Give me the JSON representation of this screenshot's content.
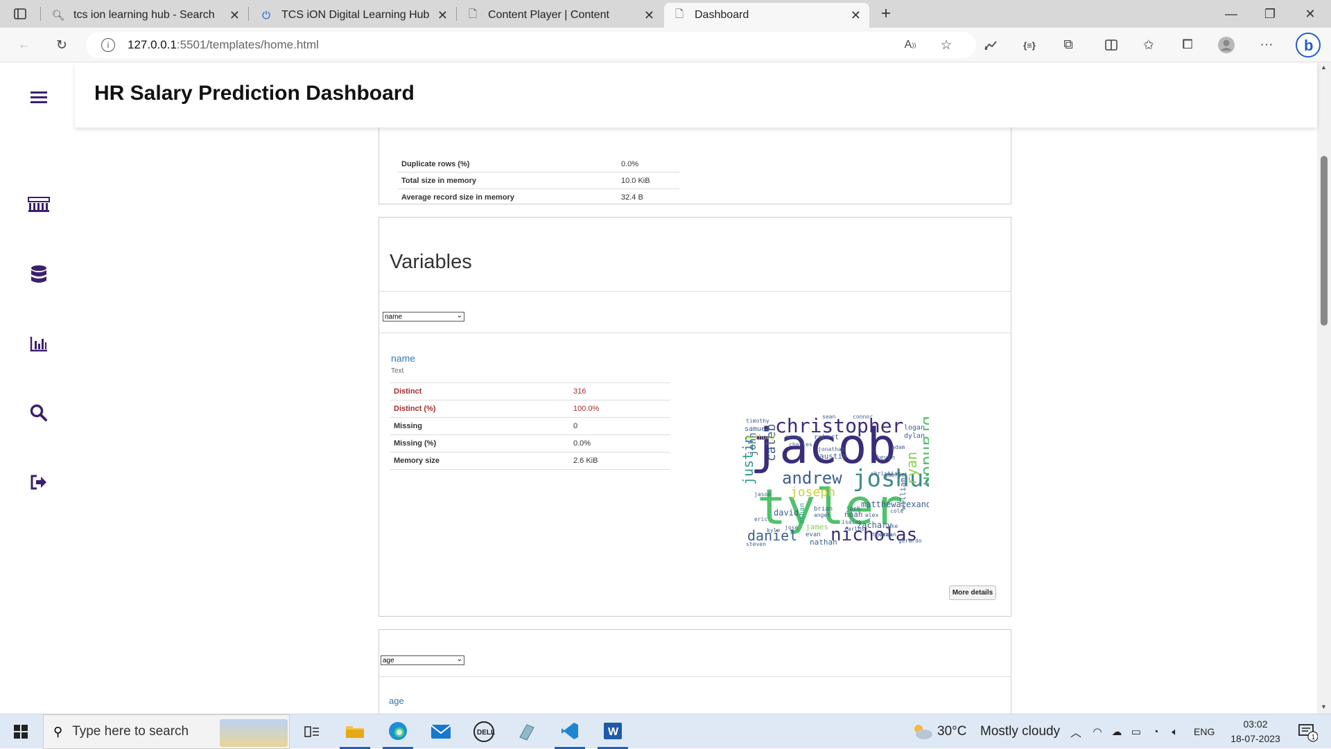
{
  "browser": {
    "tabs": [
      {
        "title": "tcs ion learning hub - Search"
      },
      {
        "title": "TCS iON Digital Learning Hub"
      },
      {
        "title": "Content Player | Content"
      },
      {
        "title": "Dashboard"
      }
    ],
    "url_host": "127.0.0.1",
    "url_path": ":5501/templates/home.html"
  },
  "header": {
    "title": "HR Salary Prediction Dashboard"
  },
  "overview_rows": [
    {
      "key": "Duplicate rows (%)",
      "value": "0.0%"
    },
    {
      "key": "Total size in memory",
      "value": "10.0 KiB"
    },
    {
      "key": "Average record size in memory",
      "value": "32.4 B"
    }
  ],
  "variables": {
    "heading": "Variables",
    "select_value": "name",
    "var_name": "name",
    "var_type": "Text",
    "rows": [
      {
        "key": "Distinct",
        "value": "316"
      },
      {
        "key": "Distinct (%)",
        "value": "100.0%"
      },
      {
        "key": "Missing",
        "value": "0"
      },
      {
        "key": "Missing (%)",
        "value": "0.0%"
      },
      {
        "key": "Memory size",
        "value": "2.6 KiB"
      }
    ],
    "more_details": "More details",
    "wordcloud_words": [
      "jacob",
      "tyler",
      "joshua",
      "christopher",
      "nicholas",
      "andrew",
      "brandon",
      "justin",
      "daniel",
      "ryan",
      "caleb",
      "joseph",
      "john",
      "matthewalexander",
      "william",
      "samuel",
      "logan",
      "dylan",
      "austin",
      "kevin",
      "robert",
      "david",
      "noah",
      "zachary",
      "james",
      "nathan",
      "ethan",
      "anthony",
      "jack",
      "christian",
      "brian",
      "angel",
      "isaiah",
      "evan",
      "jose",
      "kyle",
      "eric",
      "steven",
      "timothy",
      "jonathan",
      "charles",
      "devin",
      "alex",
      "luke",
      "gabriel",
      "cole",
      "jason",
      "thomas",
      "carlos",
      "jordan",
      "gerardo",
      "adam",
      "sean",
      "connor"
    ]
  },
  "age_section": {
    "select_value": "age",
    "var_name": "age"
  },
  "taskbar": {
    "search_placeholder": "Type here to search",
    "weather_temp": "30°C",
    "weather_desc": "Mostly cloudy",
    "lang": "ENG",
    "time": "03:02",
    "date": "18-07-2023",
    "notif_count": "1"
  }
}
